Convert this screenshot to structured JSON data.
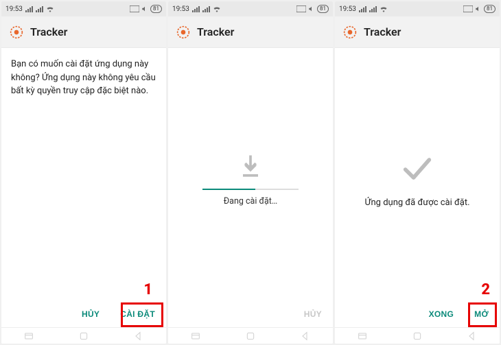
{
  "status": {
    "time": "19:53",
    "battery": "81"
  },
  "app": {
    "title": "Tracker"
  },
  "screen1": {
    "prompt": "Bạn có muốn cài đặt ứng dụng này không? Ứng dụng này không yêu cầu bất kỳ quyền truy cập đặc biệt nào.",
    "cancel": "HỦY",
    "install": "CÀI ĐẶT",
    "annotation": "1"
  },
  "screen2": {
    "status": "Đang cài đặt…",
    "cancel": "HỦY"
  },
  "screen3": {
    "status": "Ứng dụng đã được cài đặt.",
    "done": "XONG",
    "open": "MỞ",
    "annotation": "2"
  }
}
